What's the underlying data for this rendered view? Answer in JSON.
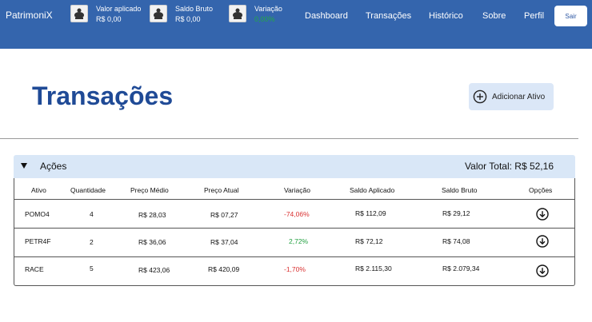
{
  "header": {
    "brand": "PatrimoniX",
    "stats": [
      {
        "label": "Valor aplicado",
        "value": "R$ 0,00",
        "icon": "piggy-bank-icon"
      },
      {
        "label": "Saldo Bruto",
        "value": "R$ 0,00",
        "icon": "piggy-bank-icon"
      },
      {
        "label": "Variação",
        "value": "0,00%",
        "icon": "piggy-bank-icon",
        "value_color": "#22aa44"
      }
    ],
    "nav": [
      "Dashboard",
      "Transações",
      "Histórico",
      "Sobre",
      "Perfil"
    ],
    "logout_label": "Sair",
    "bar_color": "#3465ad"
  },
  "page": {
    "title": "Transações",
    "add_button_label": "Adicionar Ativo",
    "add_icon": "plus-circle-icon",
    "title_color": "#1f4a96"
  },
  "section": {
    "name": "Ações",
    "total": "Valor Total: R$ 52,16",
    "columns": [
      "Ativo",
      "Quantidade",
      "Preço Médio",
      "Preço Atual",
      "Variação",
      "Saldo Aplicado",
      "Saldo Bruto",
      "Opções"
    ],
    "rows": [
      {
        "ativo": "POMO4",
        "quantidade": "4",
        "preco_medio": "R$ 28,03",
        "preco_atual": "R$ 07,27",
        "variacao": "-74,06%",
        "trend": "neg",
        "saldo_aplicado": "R$ 112,09",
        "saldo_bruto": "R$ 29,12"
      },
      {
        "ativo": "PETR4F",
        "quantidade": "2",
        "preco_medio": "R$ 36,06",
        "preco_atual": "R$ 37,04",
        "variacao": "2,72%",
        "trend": "pos",
        "saldo_aplicado": "R$ 72,12",
        "saldo_bruto": "R$ 74,08"
      },
      {
        "ativo": "RACE",
        "quantidade": "5",
        "preco_medio": "R$ 423,06",
        "preco_atual": "R$ 420,09",
        "variacao": "-1,70%",
        "trend": "neg",
        "saldo_aplicado": "R$ 2.115,30",
        "saldo_bruto": "R$ 2.079,34"
      }
    ],
    "option_icon": "chevron-down-circle-icon",
    "negative_color": "#d93030",
    "positive_color": "#22a040"
  }
}
